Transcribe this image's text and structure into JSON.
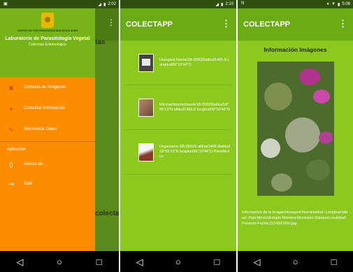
{
  "screen1": {
    "status_time": "2:02",
    "logo_caption": "CENTRO DE POSTGRADUADOS BIOLOGICA UDEM",
    "drawer_title": "Laboratorio de Parasitología Vegetal",
    "drawer_subtitle": "Colección Entomológica",
    "items": [
      {
        "label": "Consulta de Imágenes",
        "icon": "contacts-icon"
      },
      {
        "label": "Consultar Información",
        "icon": "person-icon"
      },
      {
        "label": "Sincronizar Datos",
        "icon": "sync-icon"
      }
    ],
    "section_label": "Aplicacion",
    "app_items": [
      {
        "label": "Acerca de ..",
        "icon": "phone-icon"
      },
      {
        "label": "Salir",
        "icon": "exit-icon"
      }
    ],
    "background_text_1": "tas",
    "background_text_2": "colecta"
  },
  "screen2": {
    "status_time": "2:10",
    "title": "COLECTAPP",
    "items": [
      {
        "text": "Huesped-NserieSB-00026latitud1465.9-Longitud99°10'44\"O"
      },
      {
        "text": "MicroambienteNserieSB-00026latitud18°55'13\"N altitud1465.9 longitud99°10'44\"O"
      },
      {
        "text": "Organismo-SB-00026-altitud1465.9latitud18°55'13\"N longitud99°10'44\"O PaisMéxico"
      }
    ]
  },
  "screen3": {
    "status_time": "5:08",
    "title": "COLECTAPP",
    "heading": "Información Imágenes",
    "details": "Informacion de la ImagenHuesped-Nserielatitud:-Longitud:latitud:-Pais:MéxicoEstado:Morelos-Municipio:JiutepecLocalidad: Porvenir-Fecha:1574931950.jpg"
  },
  "colors": {
    "app_green": "#6aaa12",
    "screen_green": "#8cc81e",
    "drawer_orange": "#ff8c00"
  }
}
